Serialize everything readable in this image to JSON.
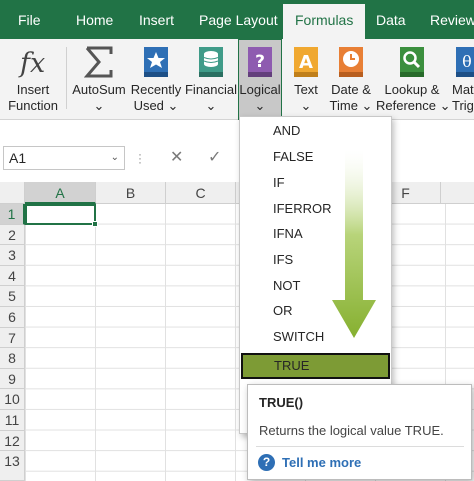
{
  "tabs": [
    {
      "label": "File"
    },
    {
      "label": "Home"
    },
    {
      "label": "Insert"
    },
    {
      "label": "Page Layout"
    },
    {
      "label": "Formulas"
    },
    {
      "label": "Data"
    },
    {
      "label": "Review"
    }
  ],
  "active_tab": "Formulas",
  "ribbon": {
    "insert_function": {
      "line1": "Insert",
      "line2": "Function",
      "icon": "fx-icon"
    },
    "autosum": {
      "line1": "AutoSum",
      "line2": "⌄",
      "icon": "sigma-icon"
    },
    "recently_used": {
      "line1": "Recently",
      "line2": "Used ⌄",
      "icon": "star-book-icon"
    },
    "financial": {
      "line1": "Financial",
      "line2": "⌄",
      "icon": "coins-book-icon"
    },
    "logical": {
      "line1": "Logical",
      "line2": "⌄",
      "icon": "question-book-icon"
    },
    "text": {
      "line1": "Text",
      "line2": "⌄",
      "icon": "letter-a-book-icon"
    },
    "date_time": {
      "line1": "Date &",
      "line2": "Time ⌄",
      "icon": "clock-book-icon"
    },
    "lookup_reference": {
      "line1": "Lookup &",
      "line2": "Reference ⌄",
      "icon": "magnifier-book-icon"
    },
    "math_trig": {
      "line1": "Mat",
      "line2": "Trig",
      "icon": "theta-book-icon"
    }
  },
  "formula_bar": {
    "name_box": "A1",
    "cancel_glyph": "✕",
    "enter_glyph": "✓"
  },
  "columns": [
    "A",
    "B",
    "C",
    "",
    "F"
  ],
  "rows": [
    "1",
    "2",
    "3",
    "4",
    "5",
    "6",
    "7",
    "8",
    "9",
    "10",
    "11",
    "12",
    "13"
  ],
  "logical_menu": {
    "items": [
      "AND",
      "FALSE",
      "IF",
      "IFERROR",
      "IFNA",
      "IFS",
      "NOT",
      "OR",
      "SWITCH",
      "TRUE"
    ],
    "highlighted": "TRUE"
  },
  "tooltip": {
    "title": "TRUE()",
    "description": "Returns the logical value TRUE.",
    "help_link": "Tell me more"
  },
  "colors": {
    "excel_green": "#217346",
    "highlight": "#7d9b35",
    "arrow": "#8fb83a"
  }
}
